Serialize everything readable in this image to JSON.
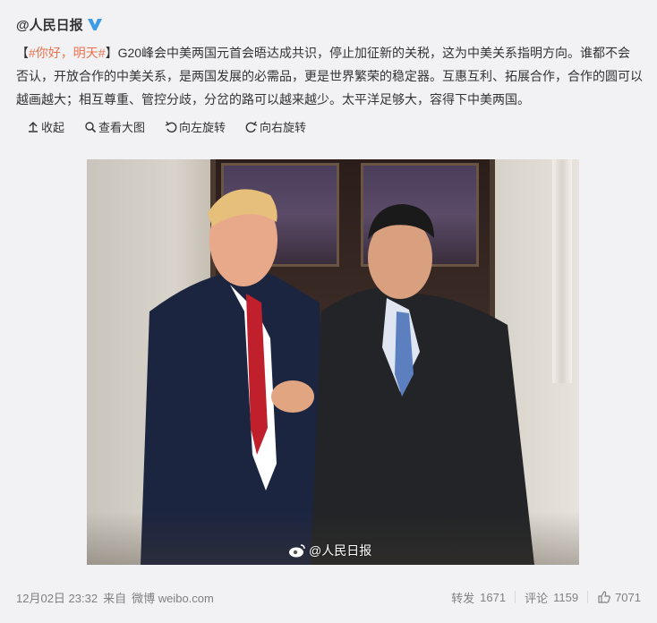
{
  "author": {
    "name": "@人民日报",
    "verified_icon": "verified-v-badge",
    "verified_color": "#3d9ce6"
  },
  "post": {
    "bracket_open": "【",
    "topic": "#你好，明天#",
    "bracket_close": "】",
    "body": "G20峰会中美两国元首会晤达成共识，停止加征新的关税，这为中美关系指明方向。谁都不会否认，开放合作的中美关系，是两国发展的必需品，更是世界繁荣的稳定器。互惠互利、拓展合作，合作的圆可以越画越大；相互尊重、管控分歧，分岔的路可以越来越少。太平洋足够大，容得下中美两国。"
  },
  "media_actions": [
    {
      "icon": "collapse-icon",
      "label": "收起"
    },
    {
      "icon": "magnify-icon",
      "label": "查看大图"
    },
    {
      "icon": "rotate-left-icon",
      "label": "向左旋转"
    },
    {
      "icon": "rotate-right-icon",
      "label": "向右旋转"
    }
  ],
  "photo": {
    "watermark": "@人民日报",
    "watermark_icon": "weibo-logo-icon"
  },
  "footer": {
    "timestamp": "12月02日 23:32",
    "source_prefix": "来自",
    "source": "微博 weibo.com",
    "repost_label": "转发",
    "repost_count": "1671",
    "comment_label": "评论",
    "comment_count": "1159",
    "like_icon": "thumbs-up-icon",
    "like_count": "7071"
  },
  "colors": {
    "topic": "#eb7350",
    "text": "#333333",
    "muted": "#808080"
  }
}
